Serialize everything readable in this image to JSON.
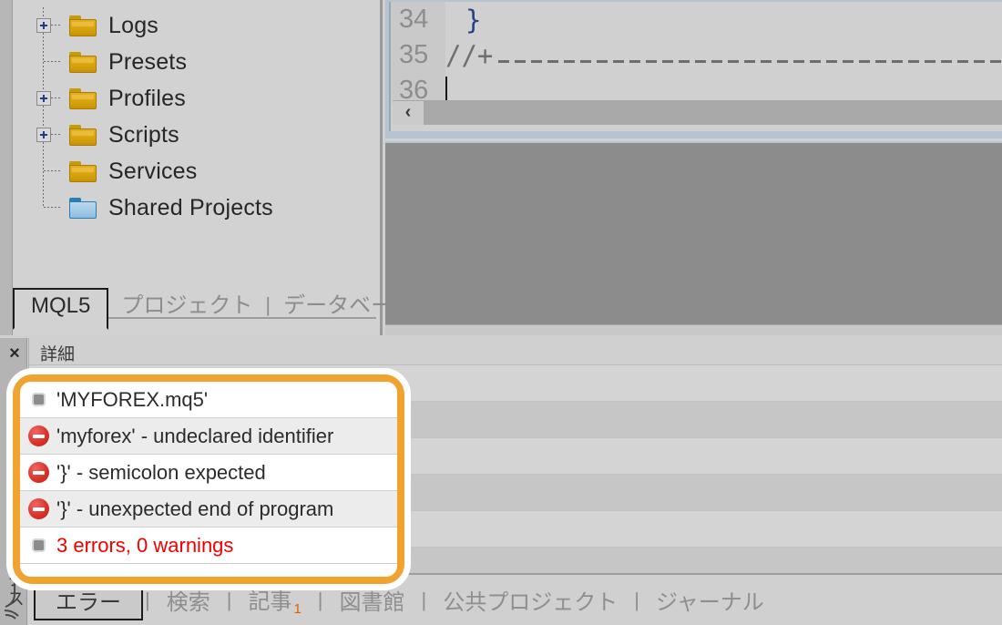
{
  "navigator": {
    "tree": [
      {
        "label": "Logs",
        "expandable": true,
        "folder": "yellow",
        "icon": "folder-icon"
      },
      {
        "label": "Presets",
        "expandable": false,
        "folder": "yellow",
        "icon": "folder-icon"
      },
      {
        "label": "Profiles",
        "expandable": true,
        "folder": "yellow",
        "icon": "folder-icon"
      },
      {
        "label": "Scripts",
        "expandable": true,
        "folder": "yellow",
        "icon": "folder-icon"
      },
      {
        "label": "Services",
        "expandable": false,
        "folder": "yellow",
        "icon": "folder-icon"
      },
      {
        "label": "Shared Projects",
        "expandable": false,
        "folder": "blue",
        "icon": "shared-folder-icon"
      }
    ],
    "tabs": [
      {
        "label": "MQL5",
        "active": true
      },
      {
        "label": "プロジェクト",
        "active": false
      },
      {
        "label": "データベース",
        "active": false
      }
    ],
    "tab_separator": "|"
  },
  "editor": {
    "lines": [
      {
        "number": "34",
        "text": "}",
        "kind": "brace"
      },
      {
        "number": "35",
        "text": "//+",
        "kind": "comment"
      },
      {
        "number": "36",
        "text": "",
        "kind": "empty"
      }
    ],
    "scroll_left_label": "‹"
  },
  "toolbox": {
    "close_label": "×",
    "vertical_label": "ツールボックス",
    "column_header": "詳細",
    "rows": [
      {
        "icon": "info-dot-icon",
        "text": "'MYFOREX.mq5'",
        "kind": "info"
      },
      {
        "icon": "error-icon",
        "text": "'myforex' - undeclared identifier",
        "kind": "error"
      },
      {
        "icon": "error-icon",
        "text": "'}' - semicolon expected",
        "kind": "error"
      },
      {
        "icon": "error-icon",
        "text": "'}' - unexpected end of program",
        "kind": "error"
      },
      {
        "icon": "info-dot-icon",
        "text": "3 errors, 0 warnings",
        "kind": "summary"
      }
    ],
    "tabs": [
      {
        "label": "エラー",
        "active": true,
        "badge": ""
      },
      {
        "label": "検索",
        "active": false,
        "badge": ""
      },
      {
        "label": "記事",
        "active": false,
        "badge": "1"
      },
      {
        "label": "図書館",
        "active": false,
        "badge": ""
      },
      {
        "label": "公共プロジェクト",
        "active": false,
        "badge": ""
      },
      {
        "label": "ジャーナル",
        "active": false,
        "badge": ""
      }
    ],
    "tab_separator": "|"
  },
  "colors": {
    "highlight": "#f0a32e",
    "error_text": "#f20000",
    "error_icon": "#d93025",
    "folder_yellow": "#d9a40f",
    "folder_blue": "#a2cae6"
  }
}
